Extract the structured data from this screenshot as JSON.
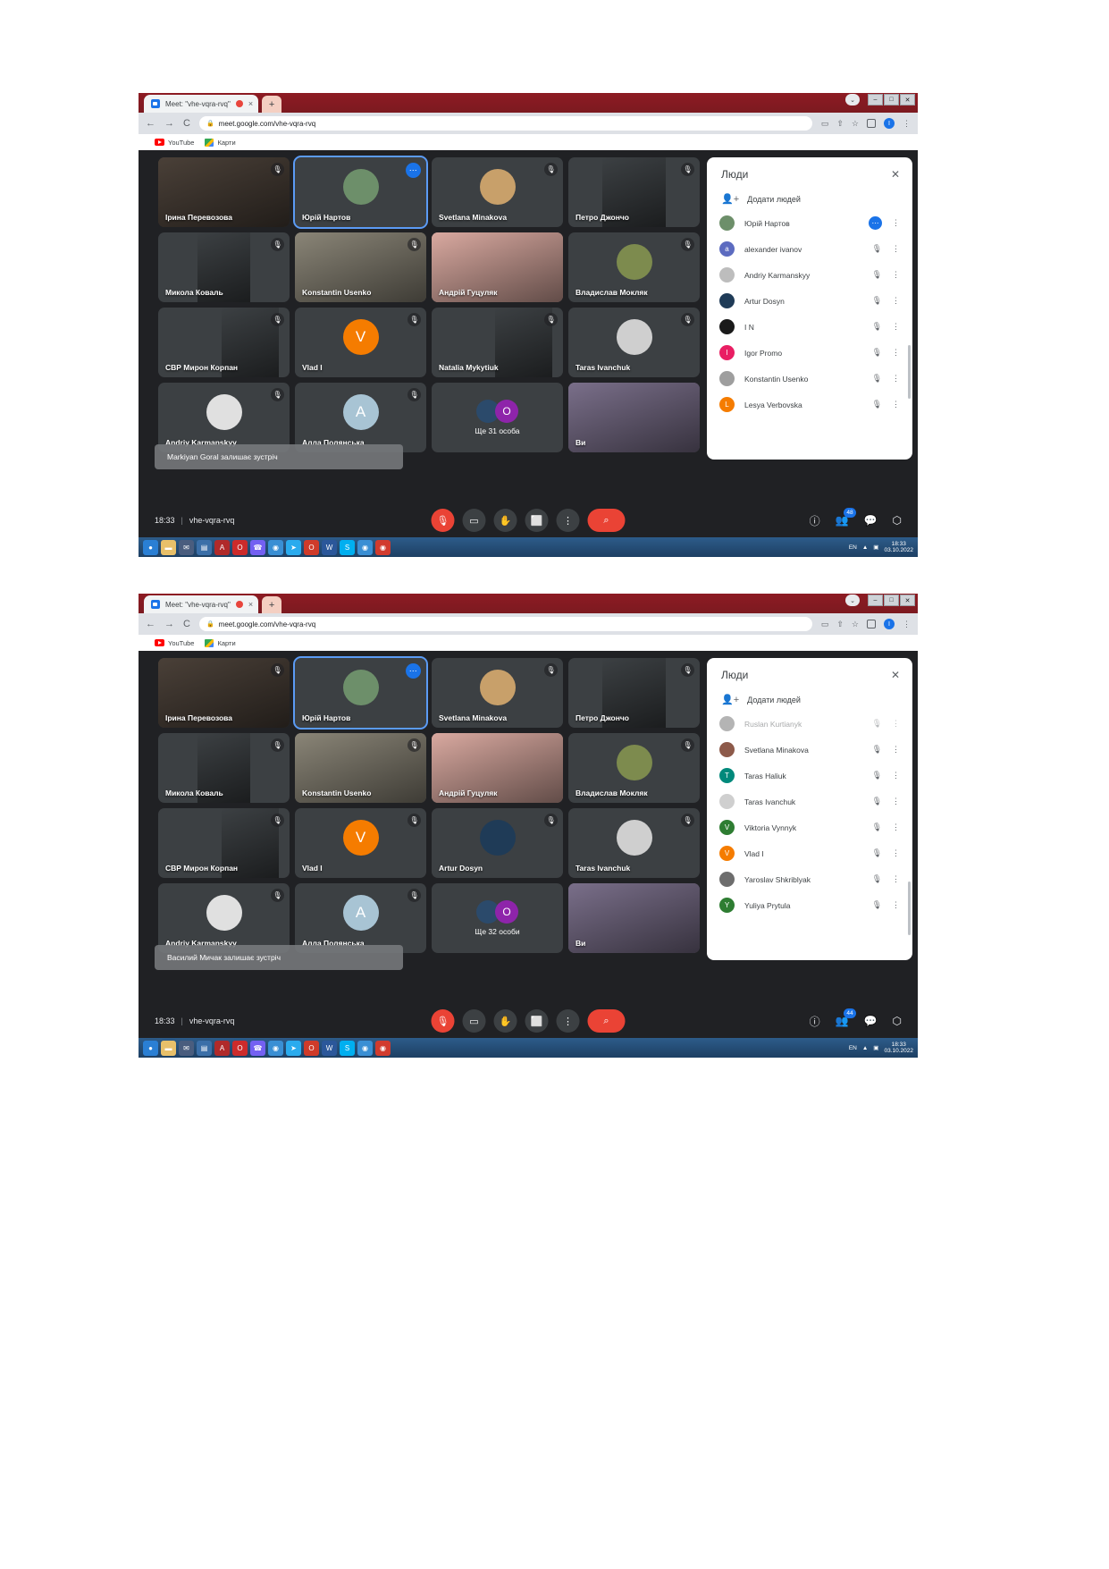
{
  "browser": {
    "tab_title": "Meet: \"vhe-vqra-rvq\"",
    "tab_close": "×",
    "new_tab": "+",
    "back": "←",
    "forward": "→",
    "reload": "C",
    "lock": "🔒",
    "url": "meet.google.com/vhe-vqra-rvq",
    "win_minimize": "–",
    "win_maximize": "□",
    "win_close": "✕",
    "win_chevron": "⌄",
    "avatar_initial": "I",
    "menu": "⋮",
    "star": "☆",
    "share": "⇧",
    "cast": "▭",
    "bookmarks": [
      {
        "label": "YouTube",
        "icon": "youtube-icon"
      },
      {
        "label": "Карти",
        "icon": "maps-icon"
      }
    ]
  },
  "meet": {
    "mic_off_glyph": "🎙",
    "more_dots": "⋯",
    "panel": {
      "title": "Люди",
      "close": "✕",
      "add_people": "Додати людей",
      "add_icon": "add-person-icon",
      "row_menu": "⋮",
      "row_mic_off": "🎙"
    },
    "controls": {
      "time": "18:33",
      "separator": "|",
      "code": "vhe-vqra-rvq",
      "mic": "🎙",
      "camera": "▭",
      "raise_hand": "✋",
      "present": "⬜",
      "more": "⋮",
      "hangup": "⌕",
      "info": "ⓘ",
      "people": "👥",
      "chat": "💬",
      "activities": "⬡"
    }
  },
  "shot1": {
    "tiles": [
      {
        "name": "Ірина Перевозова",
        "kind": "video",
        "muted": true,
        "bg": "#4a4038",
        "photo": "full"
      },
      {
        "name": "Юрій Нартов",
        "kind": "avatar-photo",
        "active": true,
        "muted": false,
        "bg": "#3c4043",
        "avatar_color": "#6d8f6a",
        "initial": ""
      },
      {
        "name": "Svetlana Minakova",
        "kind": "avatar-photo",
        "muted": true,
        "bg": "#3c4043",
        "avatar_color": "#c8a06a",
        "initial": ""
      },
      {
        "name": "Петро Джончо",
        "kind": "video",
        "muted": true,
        "bg": "#3c4043",
        "photo": "narrow"
      },
      {
        "name": "Микола Коваль",
        "kind": "video",
        "muted": true,
        "bg": "#3c4043",
        "photo": "mid"
      },
      {
        "name": "Konstantin Usenko",
        "kind": "video",
        "muted": true,
        "bg": "#8a8577",
        "photo": "full"
      },
      {
        "name": "Андрій Гуцуляк",
        "kind": "video",
        "muted": false,
        "bg": "#d9a9a0",
        "photo": "full"
      },
      {
        "name": "Владислав Мокляк",
        "kind": "avatar-photo",
        "muted": true,
        "bg": "#3c4043",
        "avatar_color": "#7d8b4e",
        "initial": ""
      },
      {
        "name": "СВР Мирон Корпан",
        "kind": "video",
        "muted": true,
        "bg": "#3c4043",
        "photo": "right"
      },
      {
        "name": "Vlad I",
        "kind": "avatar",
        "muted": true,
        "bg": "#3c4043",
        "avatar_color": "#f57c00",
        "initial": "V"
      },
      {
        "name": "Natalia Mykytiuk",
        "kind": "video",
        "muted": true,
        "bg": "#3c4043",
        "photo": "right"
      },
      {
        "name": "Taras Ivanchuk",
        "kind": "avatar-photo",
        "muted": true,
        "bg": "#3c4043",
        "avatar_color": "#cfcfcf",
        "initial": ""
      },
      {
        "name": "Andriy Karmanskyy",
        "kind": "avatar-photo",
        "muted": true,
        "bg": "#3c4043",
        "avatar_color": "#e0e0e0",
        "initial": ""
      },
      {
        "name": "Алла Полянська",
        "kind": "avatar",
        "muted": true,
        "bg": "#3c4043",
        "avatar_color": "#a8c4d4",
        "initial": "A"
      },
      {
        "name": "",
        "kind": "overflow",
        "overflow_label": "Ще 31 особа",
        "muted": false,
        "bg": "#3c4043"
      },
      {
        "name": "Ви",
        "kind": "video",
        "muted": false,
        "bg": "#7a6f8a",
        "photo": "full"
      }
    ],
    "toast": "Markiyan Goral залишає зустріч",
    "people_badge": "48",
    "participants": [
      {
        "name": "Юрій Нартов",
        "color": "#6d8f6a",
        "initial": "",
        "self_menu": true,
        "muted": false
      },
      {
        "name": "alexander ivanov",
        "color": "#5c6bc0",
        "initial": "a",
        "muted": true
      },
      {
        "name": "Andriy Karmanskyy",
        "color": "#bdbdbd",
        "initial": "",
        "muted": true
      },
      {
        "name": "Artur Dosyn",
        "color": "#1f3b57",
        "initial": "",
        "muted": true
      },
      {
        "name": "I N",
        "color": "#1a1a1a",
        "initial": "",
        "muted": true
      },
      {
        "name": "Igor Promo",
        "color": "#e91e63",
        "initial": "I",
        "muted": true
      },
      {
        "name": "Konstantin Usenko",
        "color": "#9e9e9e",
        "initial": "",
        "muted": true
      },
      {
        "name": "Lesya Verbovska",
        "color": "#f57c00",
        "initial": "L",
        "muted": true
      }
    ]
  },
  "shot2": {
    "tiles": [
      {
        "name": "Ірина Перевозова",
        "kind": "video",
        "muted": true,
        "bg": "#4a4038",
        "photo": "full"
      },
      {
        "name": "Юрій Нартов",
        "kind": "avatar-photo",
        "active": true,
        "muted": false,
        "bg": "#3c4043",
        "avatar_color": "#6d8f6a",
        "initial": ""
      },
      {
        "name": "Svetlana Minakova",
        "kind": "avatar-photo",
        "muted": true,
        "bg": "#3c4043",
        "avatar_color": "#c8a06a",
        "initial": ""
      },
      {
        "name": "Петро Джончо",
        "kind": "video",
        "muted": true,
        "bg": "#3c4043",
        "photo": "narrow"
      },
      {
        "name": "Микола Коваль",
        "kind": "video",
        "muted": true,
        "bg": "#3c4043",
        "photo": "mid"
      },
      {
        "name": "Konstantin Usenko",
        "kind": "video",
        "muted": true,
        "bg": "#8a8577",
        "photo": "full"
      },
      {
        "name": "Андрій Гуцуляк",
        "kind": "video",
        "muted": false,
        "bg": "#d9a9a0",
        "photo": "full"
      },
      {
        "name": "Владислав Мокляк",
        "kind": "avatar-photo",
        "muted": true,
        "bg": "#3c4043",
        "avatar_color": "#7d8b4e",
        "initial": ""
      },
      {
        "name": "СВР Мирон Корпан",
        "kind": "video",
        "muted": true,
        "bg": "#3c4043",
        "photo": "right"
      },
      {
        "name": "Vlad I",
        "kind": "avatar",
        "muted": true,
        "bg": "#3c4043",
        "avatar_color": "#f57c00",
        "initial": "V"
      },
      {
        "name": "Artur Dosyn",
        "kind": "avatar",
        "muted": true,
        "bg": "#3c4043",
        "avatar_color": "#1f3b57",
        "initial": ""
      },
      {
        "name": "Taras Ivanchuk",
        "kind": "avatar-photo",
        "muted": true,
        "bg": "#3c4043",
        "avatar_color": "#cfcfcf",
        "initial": ""
      },
      {
        "name": "Andriy Karmanskyy",
        "kind": "avatar-photo",
        "muted": true,
        "bg": "#3c4043",
        "avatar_color": "#e0e0e0",
        "initial": ""
      },
      {
        "name": "Алла Полянська",
        "kind": "avatar",
        "muted": true,
        "bg": "#3c4043",
        "avatar_color": "#a8c4d4",
        "initial": "A"
      },
      {
        "name": "",
        "kind": "overflow",
        "overflow_label": "Ще 32 особи",
        "muted": false,
        "bg": "#3c4043"
      },
      {
        "name": "Ви",
        "kind": "video",
        "muted": false,
        "bg": "#7a6f8a",
        "photo": "full"
      }
    ],
    "toast": "Василий Мичак залишає зустріч",
    "people_badge": "44",
    "participants": [
      {
        "name": "Ruslan Kurtianyk",
        "color": "#5a5a5a",
        "initial": "",
        "muted": true,
        "faded": true
      },
      {
        "name": "Svetlana Minakova",
        "color": "#8d5a4a",
        "initial": "",
        "muted": true
      },
      {
        "name": "Taras Haliuk",
        "color": "#00897b",
        "initial": "T",
        "muted": true
      },
      {
        "name": "Taras Ivanchuk",
        "color": "#cfcfcf",
        "initial": "",
        "muted": true
      },
      {
        "name": "Viktoria Vynnyk",
        "color": "#2e7d32",
        "initial": "V",
        "muted": true
      },
      {
        "name": "Vlad I",
        "color": "#f57c00",
        "initial": "V",
        "muted": true
      },
      {
        "name": "Yaroslav Shkriblyak",
        "color": "#6d6d6d",
        "initial": "",
        "muted": true
      },
      {
        "name": "Yuliya Prytula",
        "color": "#2e7d32",
        "initial": "Y",
        "muted": true
      }
    ]
  },
  "taskbar": {
    "icons": [
      {
        "name": "start-orb",
        "color": "#2a7fd4",
        "glyph": "●"
      },
      {
        "name": "explorer-icon",
        "color": "#e8c06a",
        "glyph": "▬"
      },
      {
        "name": "mail-icon",
        "color": "#4a5d7e",
        "glyph": "✉"
      },
      {
        "name": "save-icon",
        "color": "#3b6fa8",
        "glyph": "▤"
      },
      {
        "name": "pdf-icon",
        "color": "#b02a2a",
        "glyph": "A"
      },
      {
        "name": "opera-icon",
        "color": "#cc2b2b",
        "glyph": "O"
      },
      {
        "name": "viber-icon",
        "color": "#7360f2",
        "glyph": "☎"
      },
      {
        "name": "chrome-icon",
        "color": "#3a8fd4",
        "glyph": "◉"
      },
      {
        "name": "telegram-icon",
        "color": "#2aabee",
        "glyph": "➤"
      },
      {
        "name": "opera2-icon",
        "color": "#cf3b2a",
        "glyph": "O"
      },
      {
        "name": "word-icon",
        "color": "#2b579a",
        "glyph": "W"
      },
      {
        "name": "skype-icon",
        "color": "#00aff0",
        "glyph": "S"
      },
      {
        "name": "chrome2-icon",
        "color": "#3a8fd4",
        "glyph": "◉"
      },
      {
        "name": "meet-icon",
        "color": "#d13b2e",
        "glyph": "◉"
      }
    ],
    "lang": "EN",
    "tray_up": "▲",
    "tray_net": "▣",
    "time": "18:33",
    "date": "03.10.2022"
  }
}
